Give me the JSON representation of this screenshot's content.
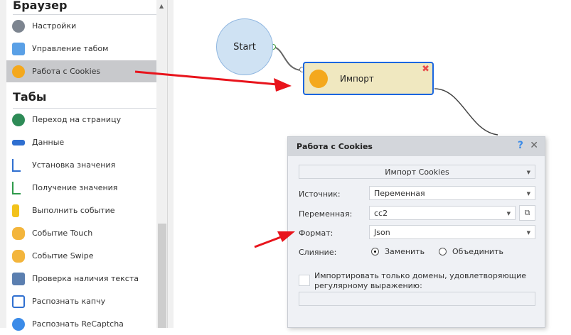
{
  "sidebar": {
    "section1": "Браузер",
    "items1": [
      {
        "label": "Настройки",
        "icon": "gear-icon"
      },
      {
        "label": "Управление табом",
        "icon": "tab-folder-icon"
      },
      {
        "label": "Работа с Cookies",
        "icon": "cookie-icon"
      }
    ],
    "section2": "Табы",
    "items2": [
      {
        "label": "Переход на страницу",
        "icon": "globe-icon"
      },
      {
        "label": "Данные",
        "icon": "html-icon"
      },
      {
        "label": "Установка значения",
        "icon": "set-arrow-icon"
      },
      {
        "label": "Получение значения",
        "icon": "get-arrow-icon"
      },
      {
        "label": "Выполнить событие",
        "icon": "lightning-icon"
      },
      {
        "label": "Событие Touch",
        "icon": "touch-icon"
      },
      {
        "label": "Событие Swipe",
        "icon": "swipe-icon"
      },
      {
        "label": "Проверка наличия текста",
        "icon": "text-check-icon"
      },
      {
        "label": "Распознать капчу",
        "icon": "captcha-icon"
      },
      {
        "label": "Распознать ReCaptcha",
        "icon": "recaptcha-icon"
      }
    ]
  },
  "canvas": {
    "start": "Start",
    "node": "Импорт"
  },
  "dialog": {
    "title": "Работа с Cookies",
    "help": "?",
    "close": "✕",
    "action": "Импорт Cookies",
    "source_label": "Источник:",
    "source_value": "Переменная",
    "variable_label": "Переменная:",
    "variable_value": "cc2",
    "format_label": "Формат:",
    "format_value": "Json",
    "merge_label": "Слияние:",
    "merge_options": [
      "Заменить",
      "Объединить"
    ],
    "merge_selected": "Заменить",
    "regex_checkbox": "Импортировать только домены, удовлетворяющие регулярному выражению:",
    "regex_checked": false,
    "regex_value": ""
  },
  "colors": {
    "accent": "#1a66e0",
    "arrow": "#e8141c",
    "selected": "#c8c9cc"
  }
}
